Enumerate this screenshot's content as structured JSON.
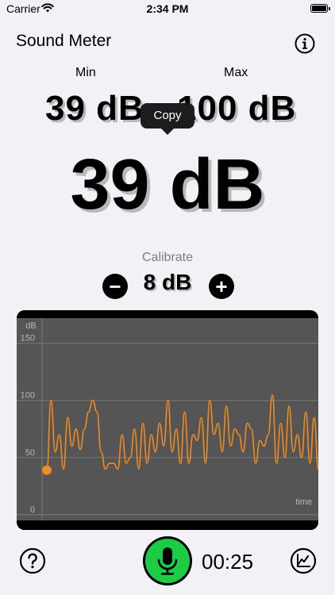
{
  "status_bar": {
    "carrier": "Carrier",
    "time": "2:34 PM"
  },
  "app": {
    "title": "Sound Meter"
  },
  "levels": {
    "min_label": "Min",
    "max_label": "Max",
    "min_value": "39 dB",
    "max_value": "100 dB",
    "current_value": "39 dB",
    "copy_tooltip": "Copy"
  },
  "calibrate": {
    "label": "Calibrate",
    "value": "8 dB",
    "minus": "−",
    "plus": "+"
  },
  "timer": {
    "elapsed": "00:25"
  },
  "icons": {
    "wifi": "wifi-icon",
    "battery": "battery-icon",
    "info": "info-icon",
    "help": "question-icon",
    "mic": "microphone-icon",
    "stats": "trend-chart-icon"
  },
  "colors": {
    "accent_green": "#1dcc45",
    "trace_orange": "#f08a24",
    "chart_bg": "#555555"
  },
  "chart_data": {
    "type": "line",
    "ylabel": "dB",
    "xlabel": "time",
    "yticks": [
      0,
      50,
      100,
      150
    ],
    "ylim": [
      -5,
      172
    ],
    "grid": true,
    "series": [
      {
        "values": [
          39,
          100,
          55,
          70,
          40,
          85,
          60,
          75,
          57,
          75,
          90,
          100,
          90,
          55,
          40,
          45,
          45,
          40,
          70,
          45,
          50,
          75,
          40,
          80,
          45,
          70,
          55,
          80,
          60,
          100,
          55,
          75,
          45,
          90,
          45,
          70,
          65,
          85,
          45,
          100,
          70,
          80,
          55,
          95,
          60,
          75,
          70,
          55,
          80,
          75,
          45,
          65,
          60,
          70,
          105,
          45,
          80,
          50,
          95,
          55,
          70,
          50,
          90,
          45,
          85,
          40
        ],
        "current_point": 39
      }
    ]
  }
}
